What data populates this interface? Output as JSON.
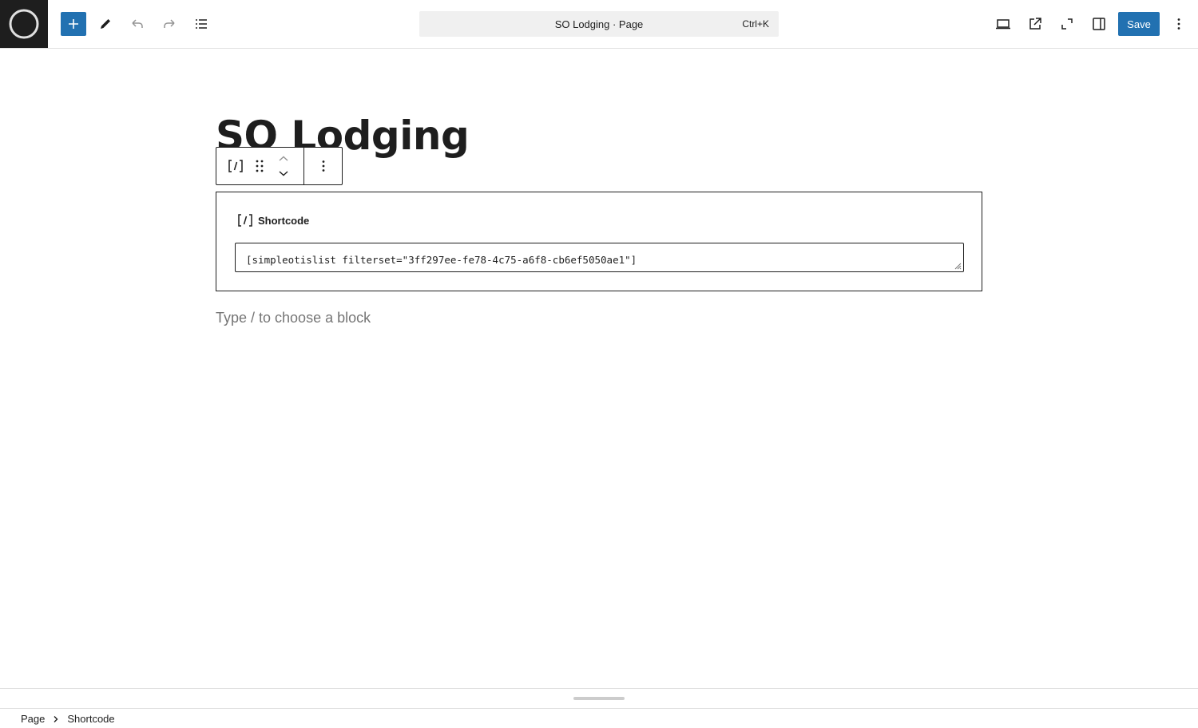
{
  "header": {
    "command_title": "SO Lodging · Page",
    "command_shortcut": "Ctrl+K",
    "save_label": "Save"
  },
  "page": {
    "title": "SO Lodging"
  },
  "shortcode_block": {
    "label": "Shortcode",
    "value": "[simpleotislist filterset=\"3ff297ee-fe78-4c75-a6f8-cb6ef5050ae1\"]"
  },
  "placeholder": "Type / to choose a block",
  "breadcrumbs": [
    "Page",
    "Shortcode"
  ],
  "colors": {
    "accent": "#2271b1",
    "text": "#1e1e1e",
    "muted": "#757575"
  }
}
